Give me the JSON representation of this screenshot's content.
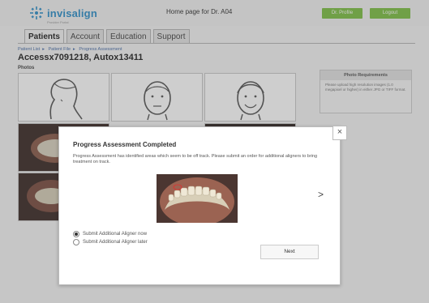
{
  "header": {
    "logo_text": "invisalign",
    "logo_sub": "Provider Portal",
    "title": "Home page for Dr. A04",
    "profile_label": "Dr. Profile",
    "logout_label": "Logout",
    "accent": "#7dbf44"
  },
  "tabs": [
    {
      "label": "Patients"
    },
    {
      "label": "Account"
    },
    {
      "label": "Education"
    },
    {
      "label": "Support"
    }
  ],
  "breadcrumb": [
    "Patient List",
    "Patient File",
    "Progress Assessment"
  ],
  "patient": {
    "name": "Accessx7091218, Autox13411"
  },
  "photos_label": "Photos",
  "requirements": {
    "title": "Photo Requirements",
    "text": "Please upload high resolution images (1.0 megapixel or higher) in either JPG or TIFF format."
  },
  "modal": {
    "title": "Progress Assessment Completed",
    "message": "Progress Assessment has identified areas which seem to be off track. Please submit an order for additional aligners to bring treatment on track.",
    "next_arrow": ">",
    "close": "×",
    "options": [
      {
        "label": "Submit Additional Aligner now",
        "selected": true
      },
      {
        "label": "Submit Additional Aligner later",
        "selected": false
      }
    ],
    "next_label": "Next"
  }
}
